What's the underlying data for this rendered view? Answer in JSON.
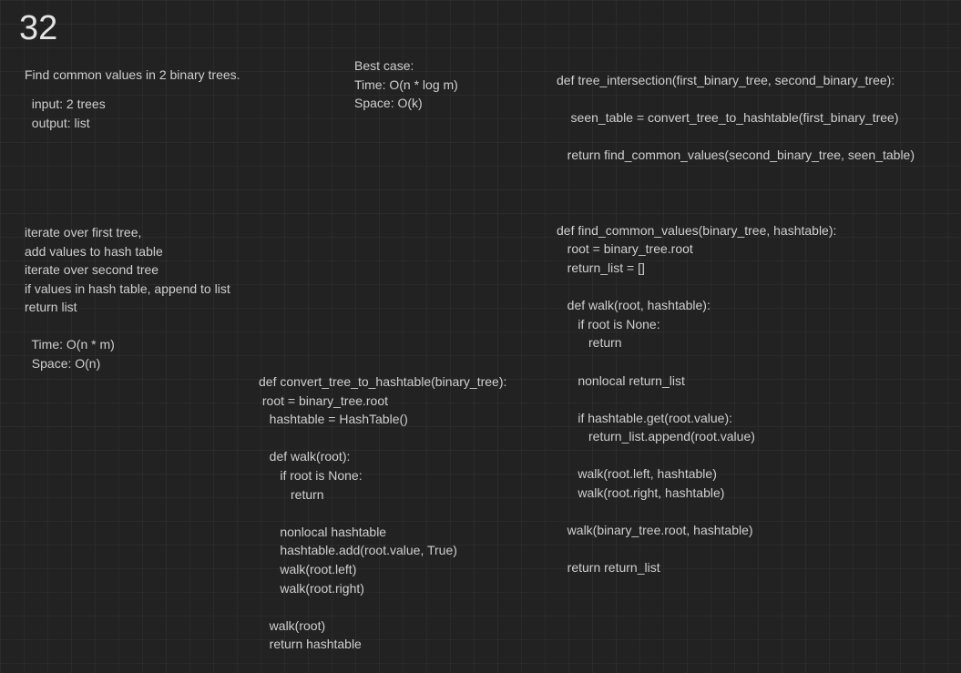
{
  "page_number": "32",
  "notes": {
    "problem_statement": [
      "Find common values in 2 binary trees."
    ],
    "io_spec": [
      "  input: 2 trees",
      "  output: list"
    ],
    "best_case": [
      "Best case:",
      "Time: O(n * log m)",
      "Space: O(k)"
    ],
    "algorithm_steps": [
      "iterate over first tree,",
      "add values to hash table",
      "iterate over second tree",
      "if values in hash table, append to list",
      "return list"
    ],
    "complexity": [
      "  Time: O(n * m)",
      "  Space: O(n)"
    ],
    "convert_function": [
      "def convert_tree_to_hashtable(binary_tree):",
      " root = binary_tree.root",
      "   hashtable = HashTable()",
      "",
      "   def walk(root):",
      "      if root is None:",
      "         return",
      "",
      "      nonlocal hashtable",
      "      hashtable.add(root.value, True)",
      "      walk(root.left)",
      "      walk(root.right)",
      "",
      "   walk(root)",
      "   return hashtable"
    ],
    "intersection_function": [
      "def tree_intersection(first_binary_tree, second_binary_tree):",
      "",
      "    seen_table = convert_tree_to_hashtable(first_binary_tree)",
      "",
      "   return find_common_values(second_binary_tree, seen_table)",
      "",
      "",
      "",
      "def find_common_values(binary_tree, hashtable):",
      "   root = binary_tree.root",
      "   return_list = []",
      "",
      "   def walk(root, hashtable):",
      "      if root is None:",
      "         return",
      "",
      "      nonlocal return_list",
      "",
      "      if hashtable.get(root.value):",
      "         return_list.append(root.value)",
      "",
      "      walk(root.left, hashtable)",
      "      walk(root.right, hashtable)",
      "",
      "   walk(binary_tree.root, hashtable)",
      "",
      "   return return_list"
    ]
  }
}
